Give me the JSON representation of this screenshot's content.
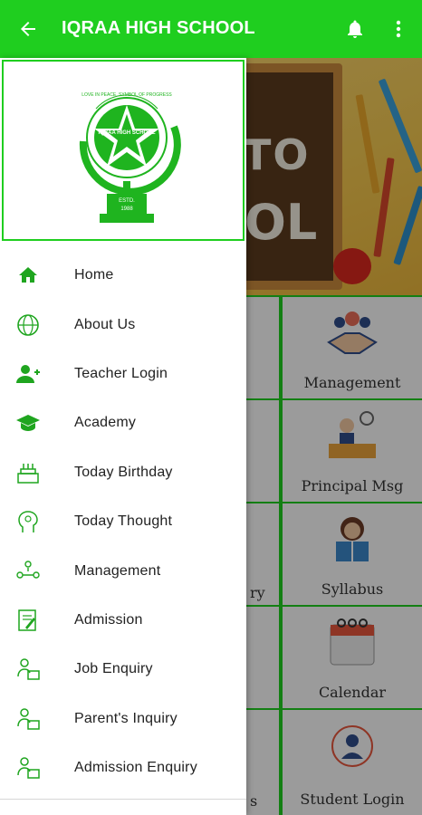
{
  "appbar": {
    "title": "IQRAA HIGH SCHOOL",
    "back_icon": "arrow-back-icon",
    "notification_icon": "bell-icon",
    "menu_icon": "more-vert-icon",
    "color": "#1fce1f"
  },
  "drawer": {
    "logo": {
      "ring_text": "LOVE IN PEACE, SYMBOL OF PROGRESS",
      "center_text": "IQRAA HIGH SCHOOL",
      "estd_label": "ESTD.",
      "estd_year": "1988"
    },
    "items": [
      {
        "label": "Home",
        "icon": "home-icon"
      },
      {
        "label": "About Us",
        "icon": "globe-info-icon"
      },
      {
        "label": "Teacher Login",
        "icon": "person-add-icon"
      },
      {
        "label": "Academy",
        "icon": "graduation-cap-icon"
      },
      {
        "label": "Today Birthday",
        "icon": "birthday-cake-icon"
      },
      {
        "label": "Today Thought",
        "icon": "thought-head-icon"
      },
      {
        "label": "Management",
        "icon": "people-network-icon"
      },
      {
        "label": "Admission",
        "icon": "document-pencil-icon"
      },
      {
        "label": "Job Enquiry",
        "icon": "person-desk-icon"
      },
      {
        "label": "Parent's Inquiry",
        "icon": "person-desk-icon"
      },
      {
        "label": "Admission Enquiry",
        "icon": "person-desk-icon"
      }
    ]
  },
  "background": {
    "banner_text": "TO",
    "banner_text2": "OL",
    "tiles": [
      {
        "label": "Management",
        "icon": "handshake-icon"
      },
      {
        "label": "Principal Msg",
        "icon": "principal-desk-icon"
      },
      {
        "label": "ry",
        "icon": "none"
      },
      {
        "label": "Syllabus",
        "icon": "student-reading-icon"
      },
      {
        "label": "Calendar",
        "icon": "calendar-icon"
      },
      {
        "label": "s",
        "icon": "none"
      },
      {
        "label": "Student Login",
        "icon": "student-target-icon"
      }
    ]
  }
}
